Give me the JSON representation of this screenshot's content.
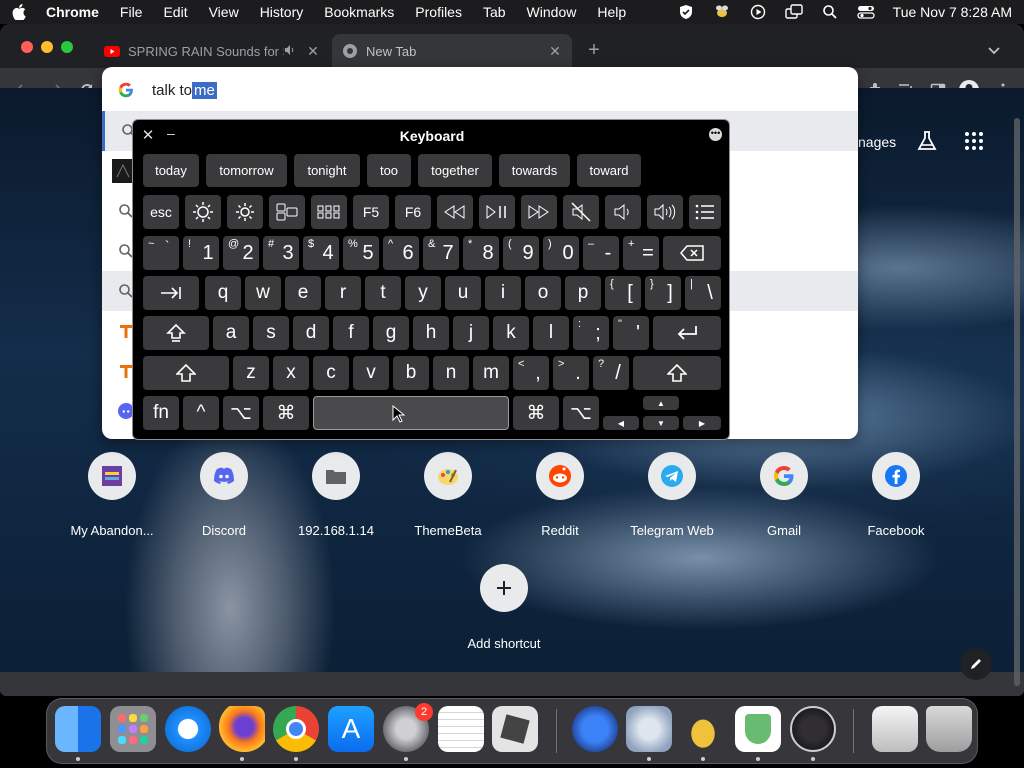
{
  "menubar": {
    "items": [
      "Chrome",
      "File",
      "Edit",
      "View",
      "History",
      "Bookmarks",
      "Profiles",
      "Tab",
      "Window",
      "Help"
    ],
    "clock": "Tue Nov 7  8:28 AM"
  },
  "tabs": [
    {
      "title": "SPRING RAIN Sounds for S",
      "active": false
    },
    {
      "title": "New Tab",
      "active": true
    }
  ],
  "omnibox": {
    "typed": "talk to",
    "autocomplete": " me"
  },
  "ntp": {
    "images_label": "nages"
  },
  "keyboard": {
    "title": "Keyboard",
    "suggestions": [
      "today",
      "tomorrow",
      "tonight",
      "too",
      "together",
      "towards",
      "toward"
    ],
    "fn_row": [
      "esc",
      "F5",
      "F6"
    ],
    "number_row": [
      {
        "top": "~",
        "sub": "`"
      },
      {
        "top": "!",
        "main": "1"
      },
      {
        "top": "@",
        "main": "2"
      },
      {
        "top": "#",
        "main": "3"
      },
      {
        "top": "$",
        "main": "4"
      },
      {
        "top": "%",
        "main": "5"
      },
      {
        "top": "^",
        "main": "6"
      },
      {
        "top": "&",
        "main": "7"
      },
      {
        "top": "*",
        "main": "8"
      },
      {
        "top": "(",
        "main": "9"
      },
      {
        "top": ")",
        "main": "0"
      },
      {
        "top": "–",
        "main": "-"
      },
      {
        "top": "+",
        "main": "="
      }
    ],
    "row_q": [
      "q",
      "w",
      "e",
      "r",
      "t",
      "y",
      "u",
      "i",
      "o",
      "p"
    ],
    "row_q_sym": [
      {
        "top": "{",
        "main": "["
      },
      {
        "top": "}",
        "main": "]"
      },
      {
        "top": "|",
        "main": "\\"
      }
    ],
    "row_a": [
      "a",
      "s",
      "d",
      "f",
      "g",
      "h",
      "j",
      "k",
      "l"
    ],
    "row_a_sym": [
      {
        "top": ":",
        "main": ";"
      },
      {
        "top": "\"",
        "main": "'"
      }
    ],
    "row_z": [
      "z",
      "x",
      "c",
      "v",
      "b",
      "n",
      "m"
    ],
    "row_z_sym": [
      {
        "top": "<",
        "main": ","
      },
      {
        "top": ">",
        "main": "."
      },
      {
        "top": "?",
        "main": "/"
      }
    ],
    "bottom": {
      "fn": "fn",
      "ctrl": "^",
      "opt": "⌥",
      "cmd": "⌘"
    }
  },
  "shortcuts": [
    {
      "label": "My Abandon...",
      "icon": "my-abandonware-icon"
    },
    {
      "label": "Discord",
      "icon": "discord-icon"
    },
    {
      "label": "192.168.1.14",
      "icon": "folder-icon"
    },
    {
      "label": "ThemeBeta",
      "icon": "themebeta-icon"
    },
    {
      "label": "Reddit",
      "icon": "reddit-icon"
    },
    {
      "label": "Telegram Web",
      "icon": "telegram-icon"
    },
    {
      "label": "Gmail",
      "icon": "google-icon"
    },
    {
      "label": "Facebook",
      "icon": "facebook-icon"
    }
  ],
  "add_shortcut": "Add shortcut",
  "dock": {
    "system_preferences_badge": "2"
  },
  "colors": {
    "accent": "#3d6cc5",
    "key_bg": "#3a3a3c"
  }
}
